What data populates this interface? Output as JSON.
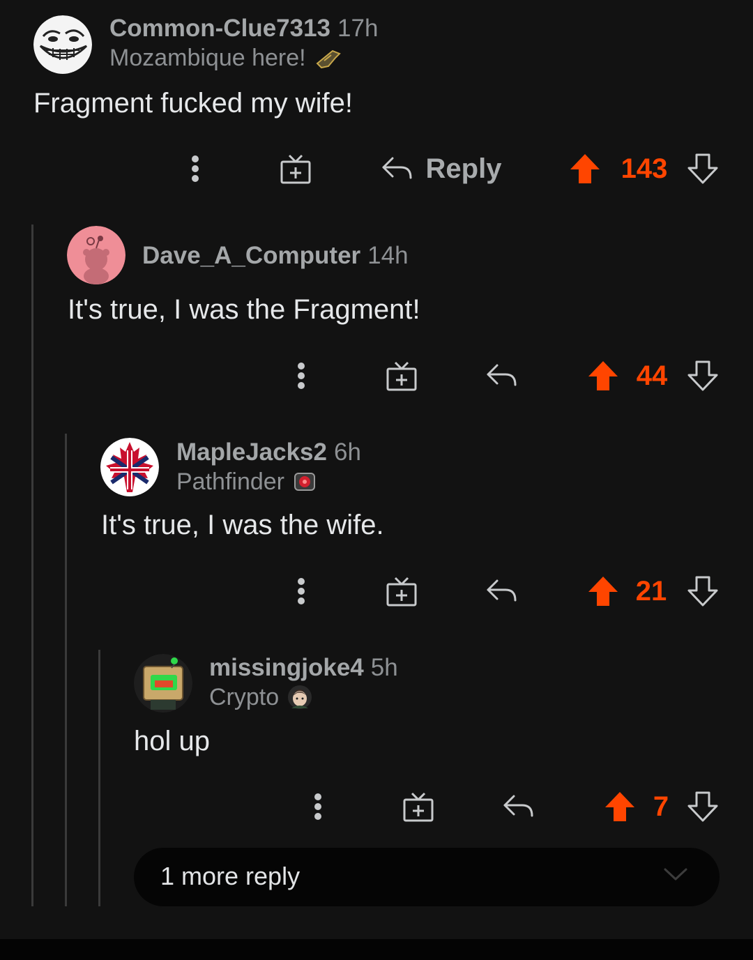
{
  "comments": [
    {
      "username": "Common-Clue7313",
      "time": "17h",
      "flair": "Mozambique here!",
      "body": "Fragment fucked my wife!",
      "reply_label": "Reply",
      "score": "143",
      "avatar_icon": "troll-face-avatar",
      "flair_icon": "mozambique-gun-icon"
    },
    {
      "username": "Dave_A_Computer",
      "time": "14h",
      "body": "It's true, I was the Fragment!",
      "score": "44",
      "avatar_icon": "default-snoo-avatar"
    },
    {
      "username": "MapleJacks2",
      "time": "6h",
      "flair": "Pathfinder",
      "body": "It's true, I was the wife.",
      "score": "21",
      "avatar_icon": "union-jack-maple-leaf-avatar",
      "flair_icon": "pathfinder-icon"
    },
    {
      "username": "missingjoke4",
      "time": "5h",
      "flair": "Crypto",
      "body": "hol up",
      "score": "7",
      "avatar_icon": "robot-box-avatar",
      "flair_icon": "crypto-icon"
    }
  ],
  "more_replies": {
    "label": "1 more reply"
  },
  "colors": {
    "background": "#121212",
    "upvote": "#ff4500",
    "thread_line": "#3a3a3a",
    "username": "#a4a7a9"
  }
}
